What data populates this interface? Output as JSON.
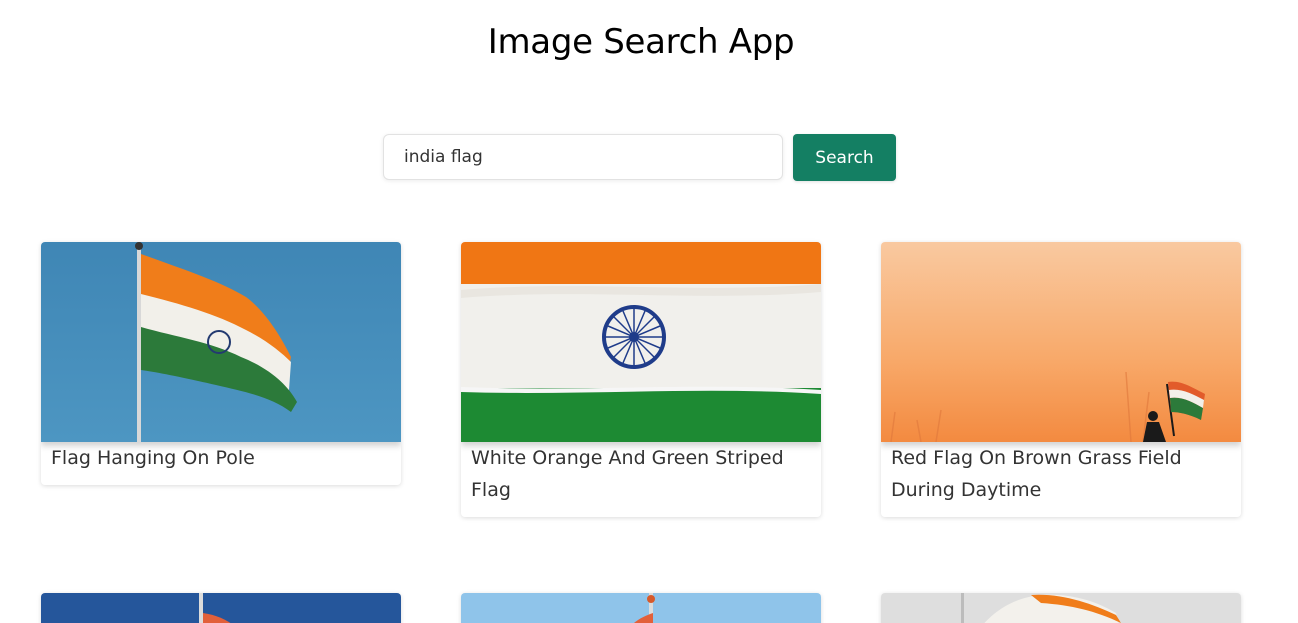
{
  "header": {
    "title": "Image Search App"
  },
  "search": {
    "value": "india flag",
    "placeholder": "",
    "button_label": "Search"
  },
  "results": [
    {
      "title": "Flag Hanging On Pole"
    },
    {
      "title": "White Orange And Green Striped Flag"
    },
    {
      "title": "Red Flag On Brown Grass Field During Daytime"
    }
  ],
  "colors": {
    "accent": "#147f63",
    "saffron": "#f07d1a",
    "green": "#1d8a33",
    "chakra": "#1f3c8a"
  }
}
